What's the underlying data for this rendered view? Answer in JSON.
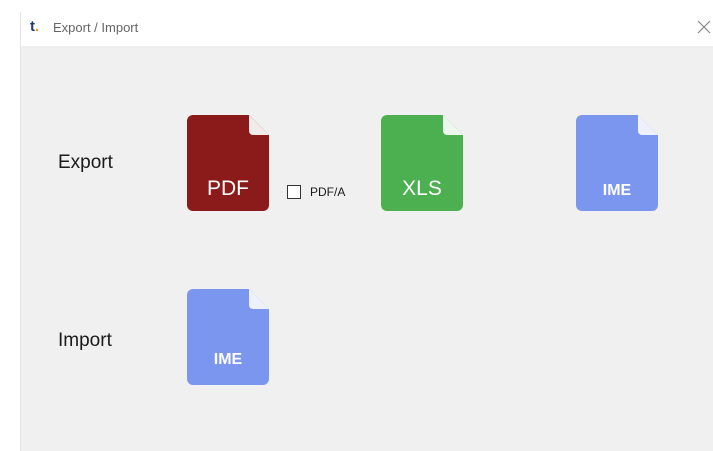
{
  "window": {
    "logo": "t",
    "logo_dot": ".",
    "title": "Export / Import",
    "close_glyph": "close-icon"
  },
  "export": {
    "label": "Export",
    "pdf": {
      "ext": "PDF",
      "color": "#8b1a1a"
    },
    "pdfa": {
      "label": "PDF/A",
      "checked": false
    },
    "xls": {
      "ext": "XLS",
      "color": "#4caf50"
    },
    "ime": {
      "ext": "IME",
      "color": "#7b96ee"
    }
  },
  "import": {
    "label": "Import",
    "ime": {
      "ext": "IME",
      "color": "#7b96ee"
    }
  }
}
